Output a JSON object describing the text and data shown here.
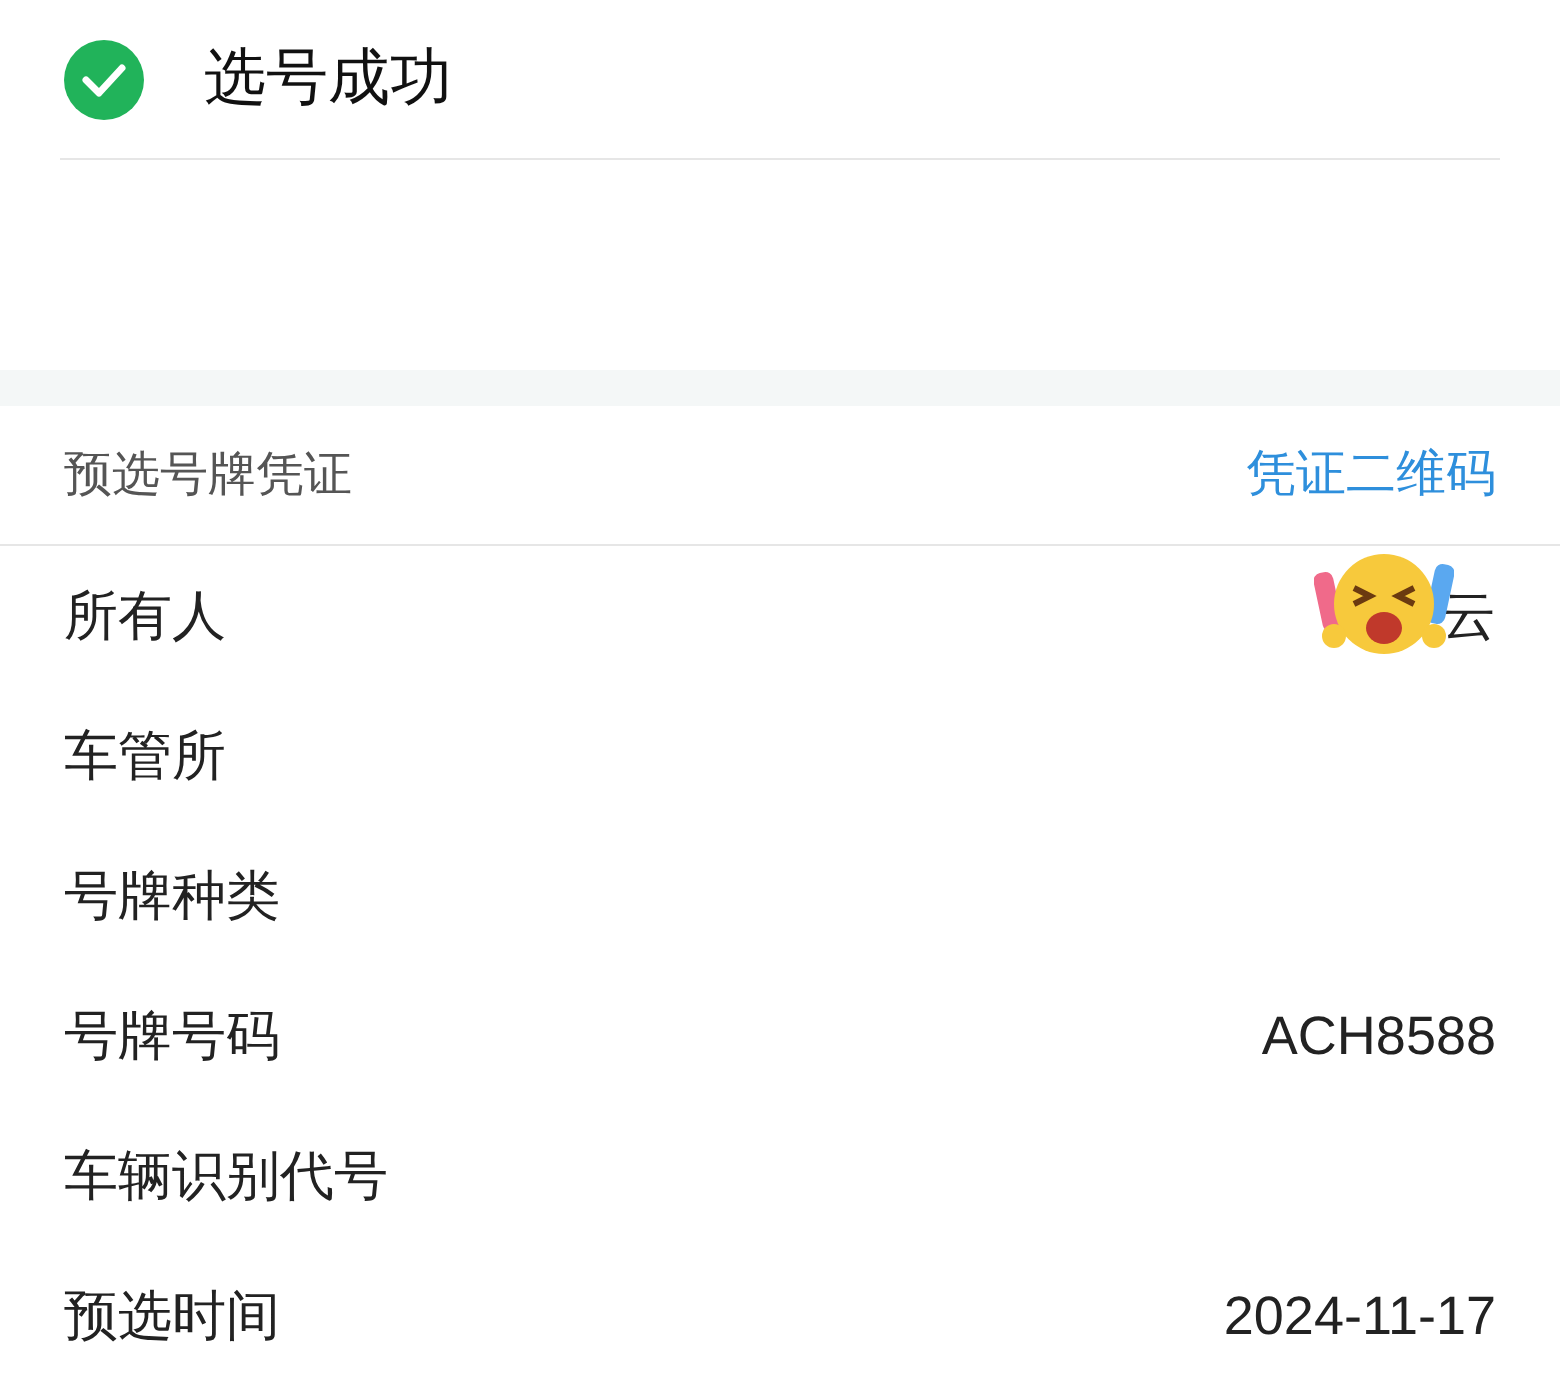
{
  "status": {
    "title": "选号成功",
    "success": true
  },
  "section": {
    "title": "预选号牌凭证",
    "link": "凭证二维码"
  },
  "rows": [
    {
      "label": "所有人",
      "value": "云",
      "covered": true
    },
    {
      "label": "车管所"
    },
    {
      "label": "号牌种类"
    },
    {
      "label": "号牌号码",
      "value": "ACH8588"
    },
    {
      "label": "车辆识别代号"
    },
    {
      "label": "预选时间",
      "value": "2024-11-17"
    }
  ]
}
